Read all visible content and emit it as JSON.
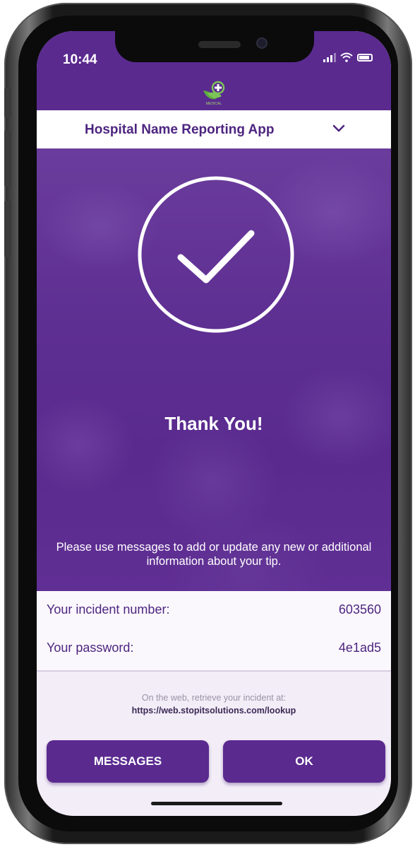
{
  "status": {
    "time": "10:44"
  },
  "logo": {
    "text": "MEDICAL"
  },
  "header": {
    "app_title": "Hospital Name Reporting App"
  },
  "confirmation": {
    "title": "Thank You!",
    "message": "Please use messages to add or update any new or additional information about your tip."
  },
  "incident": {
    "number_label": "Your incident number:",
    "number_value": "603560",
    "password_label": "Your password:",
    "password_value": "4e1ad5"
  },
  "web": {
    "note": "On the web, retrieve your incident at:",
    "url": "https://web.stopitsolutions.com/lookup"
  },
  "actions": {
    "messages_label": "MESSAGES",
    "ok_label": "OK"
  },
  "colors": {
    "brand_purple": "#5a2a8f",
    "text_purple": "#4d2580",
    "logo_green": "#6fb94a"
  },
  "icons": [
    "medical-logo-icon",
    "chevron-down-icon",
    "checkmark-circle-icon",
    "signal-icon",
    "wifi-icon",
    "battery-icon"
  ]
}
